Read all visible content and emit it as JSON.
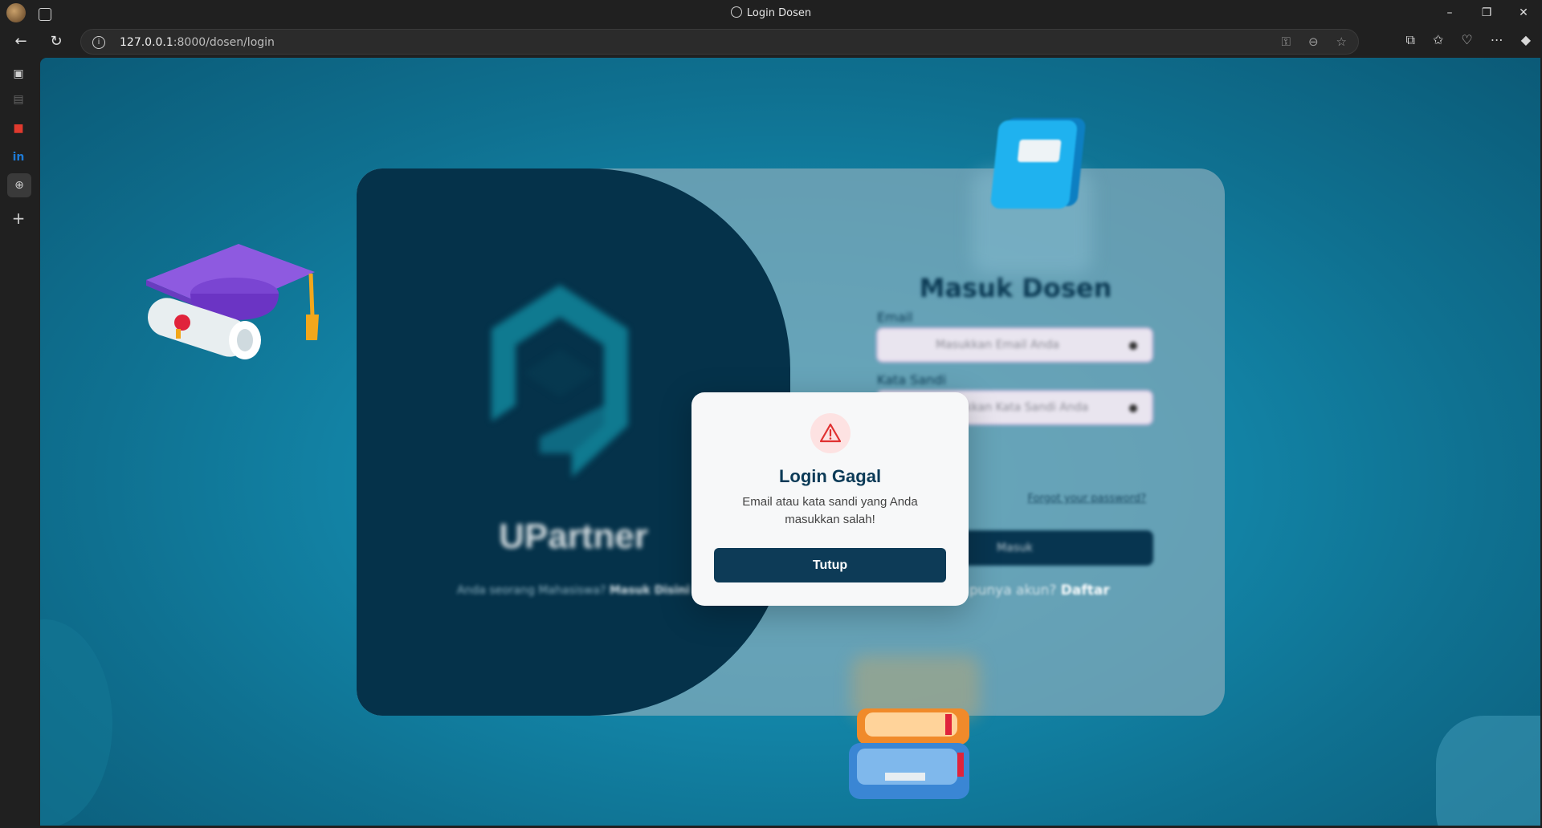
{
  "browser": {
    "tab_title": "Login Dosen",
    "url_host": "127.0.0.1",
    "url_rest": ":8000/dosen/login",
    "window_controls": {
      "minimize": "–",
      "maximize": "❐",
      "close": "✕"
    }
  },
  "page": {
    "brand": "UPartner",
    "switch_prompt": "Anda seorang Mahasiswa?",
    "switch_link": "Masuk Disini",
    "form_title": "Masuk Dosen",
    "email_label": "Email",
    "email_placeholder": "Masukkan Email Anda",
    "password_label": "Kata Sandi",
    "password_placeholder": "Masukkan Kata Sandi Anda",
    "forgot_link": "Forgot your password?",
    "submit_label": "Masuk",
    "register_prompt": "Belum punya akun?",
    "register_link": "Daftar"
  },
  "modal": {
    "title": "Login Gagal",
    "message": "Email atau kata sandi yang Anda masukkan salah!",
    "button": "Tutup",
    "icon": "warning-triangle-icon"
  },
  "colors": {
    "primary": "#0d3b57",
    "background": "#1388ab",
    "warning": "#e03131"
  }
}
